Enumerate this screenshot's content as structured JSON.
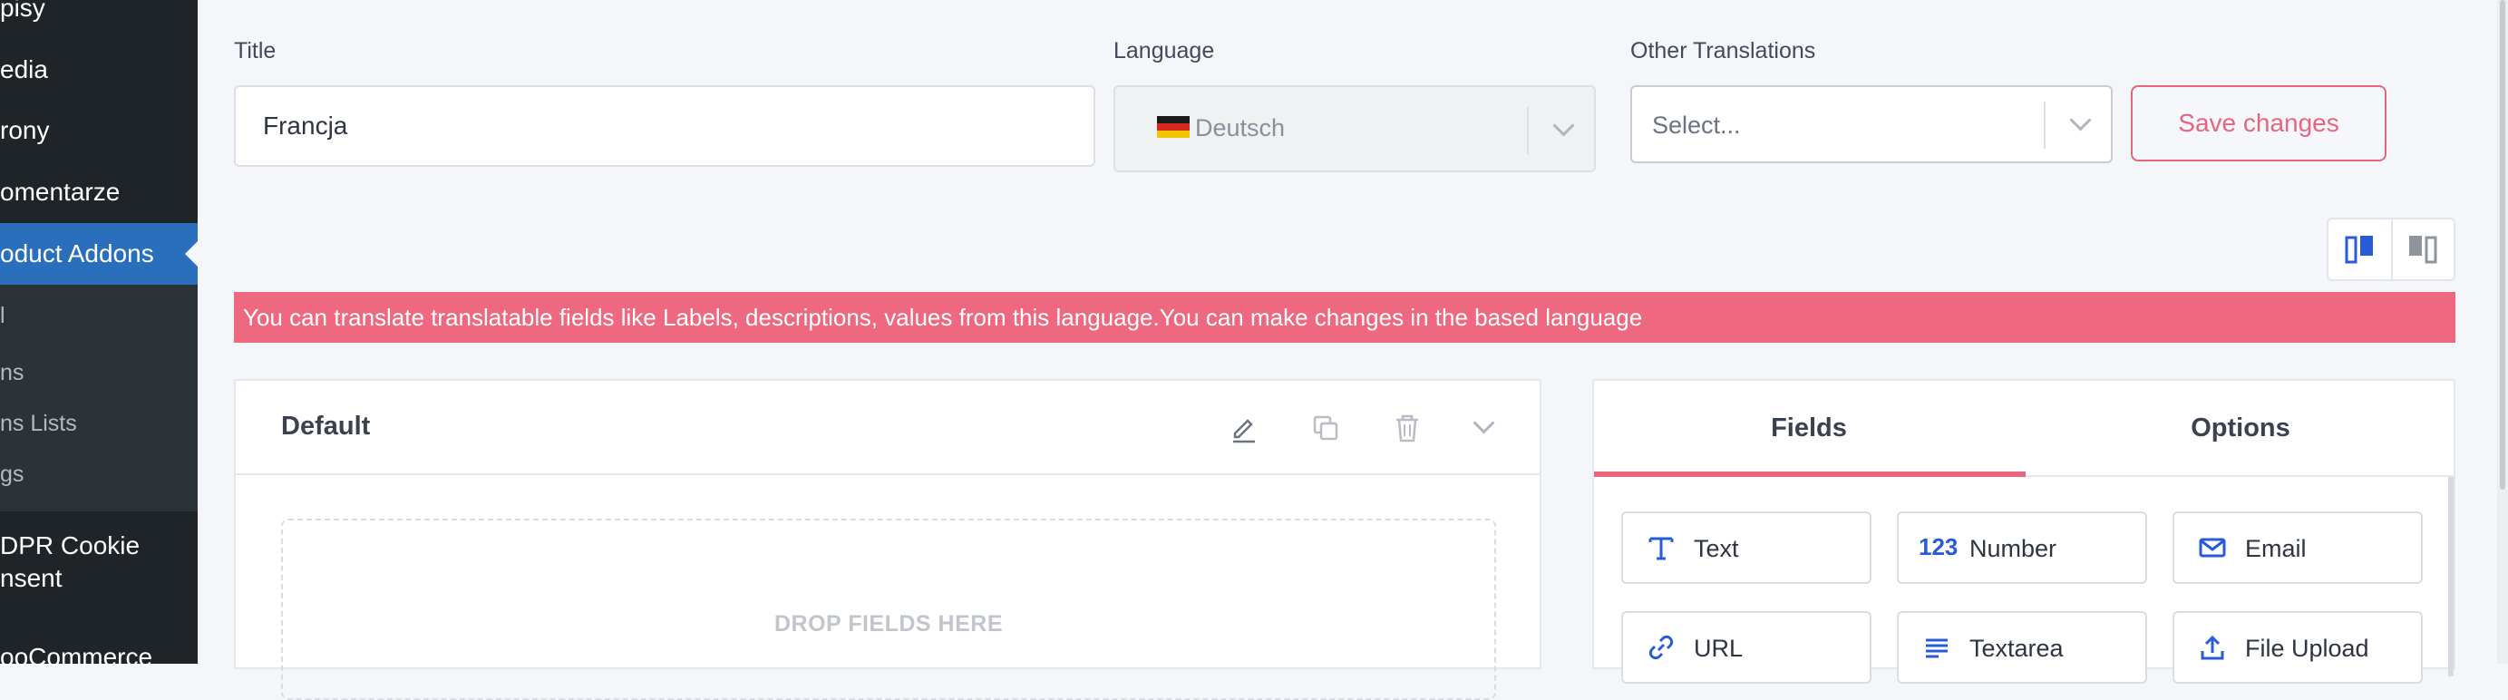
{
  "sidebar": {
    "items": [
      {
        "label": "pisy"
      },
      {
        "label": "edia"
      },
      {
        "label": "rony"
      },
      {
        "label": "omentarze"
      },
      {
        "label": "oduct Addons"
      },
      {
        "label": "DPR Cookie"
      },
      {
        "label": "nsent"
      },
      {
        "label": "ooCommerce"
      }
    ],
    "subitems": [
      {
        "label": "l"
      },
      {
        "label": "ns"
      },
      {
        "label": "ns Lists"
      },
      {
        "label": "gs"
      }
    ]
  },
  "form": {
    "title_label": "Title",
    "title_value": "Francja",
    "language_label": "Language",
    "language_value": "Deutsch",
    "other_label": "Other Translations",
    "other_placeholder": "Select...",
    "save_label": "Save changes"
  },
  "banner": {
    "text": "You can translate translatable fields like Labels, descriptions, values from this language.You can make changes in the based language"
  },
  "panel": {
    "title": "Default",
    "drop_text": "DROP FIELDS HERE"
  },
  "right_panel": {
    "tabs": [
      {
        "label": "Fields"
      },
      {
        "label": "Options"
      }
    ],
    "fields": [
      {
        "label": "Text",
        "icon": "text-icon"
      },
      {
        "label": "Number",
        "icon": "number-icon",
        "glyph": "123"
      },
      {
        "label": "Email",
        "icon": "email-icon"
      },
      {
        "label": "URL",
        "icon": "link-icon"
      },
      {
        "label": "Textarea",
        "icon": "textarea-icon"
      },
      {
        "label": "File Upload",
        "icon": "upload-icon"
      }
    ]
  },
  "colors": {
    "accent": "#e8657f",
    "banner": "#ee687f",
    "sidebar": "#1f2429",
    "sidebar_active": "#2a6fbb",
    "icon_blue": "#2a5bd7"
  }
}
